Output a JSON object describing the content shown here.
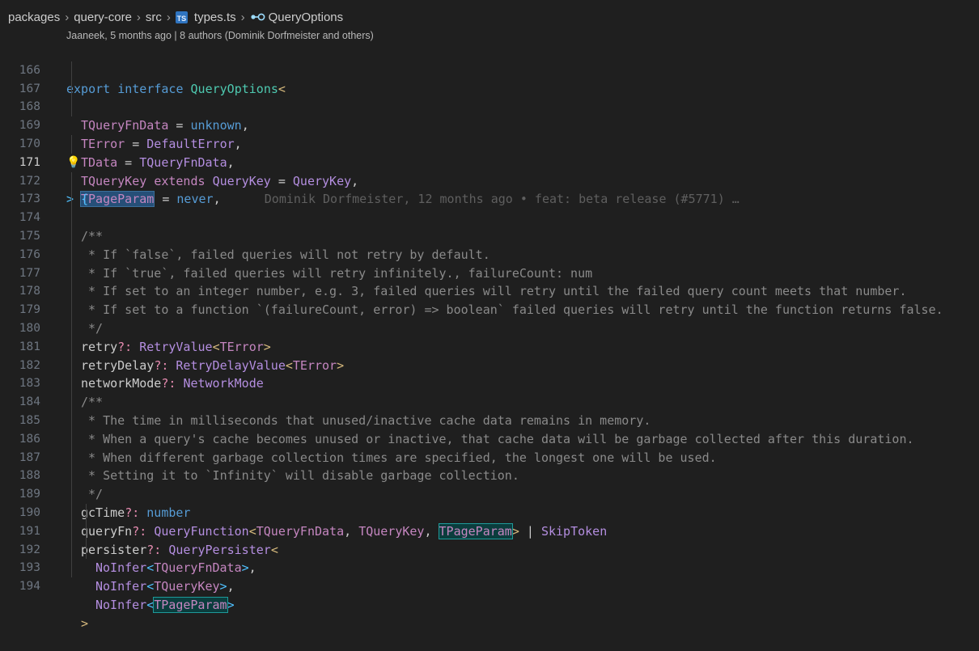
{
  "breadcrumb": {
    "items": [
      "packages",
      "query-core",
      "src",
      "types.ts",
      "QueryOptions"
    ],
    "file_icon": "TS",
    "symbol_icon": "interface-symbol-icon"
  },
  "codelens": "Jaaneek, 5 months ago | 8 authors (Dominik Dorfmeister and others)",
  "blame": "Dominik Dorfmeister, 12 months ago • feat: beta release (#5771) …",
  "colors": {
    "background": "#1f1f1f",
    "keyword": "#569cd6",
    "type": "#b48ee0",
    "comment": "#8a8a8a",
    "selection": "#264f78"
  },
  "lines": [
    {
      "n": "166"
    },
    {
      "n": "167"
    },
    {
      "n": "168"
    },
    {
      "n": "169"
    },
    {
      "n": "170"
    },
    {
      "n": "171"
    },
    {
      "n": "172"
    },
    {
      "n": "173"
    },
    {
      "n": "174"
    },
    {
      "n": "175"
    },
    {
      "n": "176"
    },
    {
      "n": "177"
    },
    {
      "n": "178"
    },
    {
      "n": "179"
    },
    {
      "n": "180"
    },
    {
      "n": "181"
    },
    {
      "n": "182"
    },
    {
      "n": "183"
    },
    {
      "n": "184"
    },
    {
      "n": "185"
    },
    {
      "n": "186"
    },
    {
      "n": "187"
    },
    {
      "n": "188"
    },
    {
      "n": "189"
    },
    {
      "n": "190"
    },
    {
      "n": "191"
    },
    {
      "n": "192"
    },
    {
      "n": "193"
    },
    {
      "n": "194"
    }
  ],
  "active_line": "171",
  "code": {
    "l166": [
      "export",
      "interface",
      "QueryOptions",
      "<"
    ],
    "l167": [
      "TQueryFnData",
      " = ",
      "unknown",
      ","
    ],
    "l168": [
      "TError",
      " = ",
      "DefaultError",
      ","
    ],
    "l169": [
      "TData",
      " = ",
      "TQueryFnData",
      ","
    ],
    "l170": [
      "TQueryKey",
      "extends",
      "QueryKey",
      " = ",
      "QueryKey",
      ","
    ],
    "l171": [
      "TPageParam",
      " = ",
      "never",
      ","
    ],
    "l172": [
      "> ",
      "{"
    ],
    "l173": "/**",
    "l174": " * If `false`, failed queries will not retry by default.",
    "l175": " * If `true`, failed queries will retry infinitely., failureCount: num",
    "l176": " * If set to an integer number, e.g. 3, failed queries will retry until the failed query count meets that number.",
    "l177": " * If set to a function `(failureCount, error) => boolean` failed queries will retry until the function returns false.",
    "l178": " */",
    "l179": [
      "retry",
      "?:",
      "RetryValue",
      "<",
      "TError",
      ">"
    ],
    "l180": [
      "retryDelay",
      "?:",
      "RetryDelayValue",
      "<",
      "TError",
      ">"
    ],
    "l181": [
      "networkMode",
      "?:",
      "NetworkMode"
    ],
    "l182": "/**",
    "l183": " * The time in milliseconds that unused/inactive cache data remains in memory.",
    "l184": " * When a query's cache becomes unused or inactive, that cache data will be garbage collected after this duration.",
    "l185": " * When different garbage collection times are specified, the longest one will be used.",
    "l186": " * Setting it to `Infinity` will disable garbage collection.",
    "l187": " */",
    "l188": [
      "gcTime",
      "?:",
      "number"
    ],
    "l189": [
      "queryFn",
      "?:",
      "QueryFunction",
      "<",
      "TQueryFnData",
      ", ",
      "TQueryKey",
      ", ",
      "TPageParam",
      ">",
      " | ",
      "SkipToken"
    ],
    "l190": [
      "persister",
      "?:",
      "QueryPersister",
      "<"
    ],
    "l191": [
      "NoInfer",
      "<",
      "TQueryFnData",
      ">",
      ","
    ],
    "l192": [
      "NoInfer",
      "<",
      "TQueryKey",
      ">",
      ","
    ],
    "l193": [
      "NoInfer",
      "<",
      "TPageParam",
      ">"
    ],
    "l194": [
      ">"
    ]
  }
}
